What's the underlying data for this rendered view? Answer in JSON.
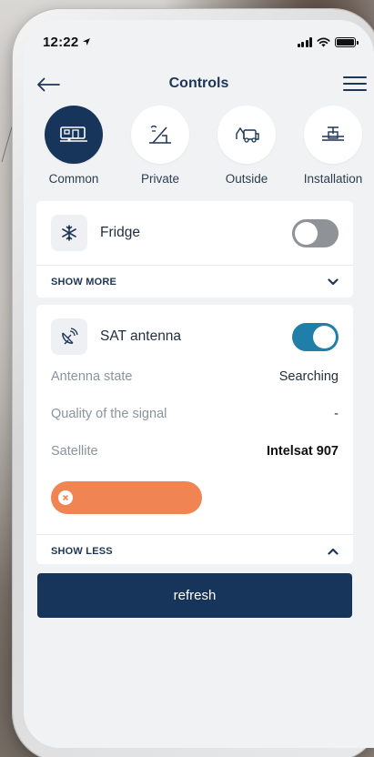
{
  "status_bar": {
    "time": "12:22"
  },
  "header": {
    "title": "Controls"
  },
  "categories": [
    {
      "label": "Common",
      "active": true
    },
    {
      "label": "Private",
      "active": false
    },
    {
      "label": "Outside",
      "active": false
    },
    {
      "label": "Installation",
      "active": false
    }
  ],
  "fridge": {
    "name": "Fridge",
    "enabled": false,
    "footer_label": "SHOW MORE"
  },
  "sat_antenna": {
    "name": "SAT antenna",
    "enabled": true,
    "details": [
      {
        "key": "Antenna state",
        "value": "Searching"
      },
      {
        "key": "Quality of the signal",
        "value": "-"
      },
      {
        "key": "Satellite",
        "value": "Intelsat 907"
      }
    ],
    "footer_label": "SHOW LESS"
  },
  "actions": {
    "refresh_label": "refresh"
  },
  "colors": {
    "primary": "#17345a",
    "toggle_on": "#1f7fa8",
    "toggle_off": "#8f9296",
    "orange": "#f08453"
  }
}
